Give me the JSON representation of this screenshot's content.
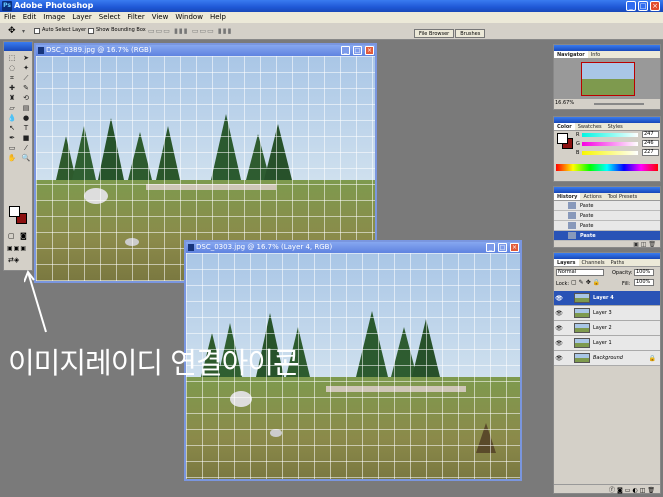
{
  "app": {
    "title": "Adobe Photoshop",
    "icon": "photoshop-icon"
  },
  "window_controls": {
    "minimize": "_",
    "maximize": "□",
    "close": "×"
  },
  "menu": [
    "File",
    "Edit",
    "Image",
    "Layer",
    "Select",
    "Filter",
    "View",
    "Window",
    "Help"
  ],
  "options": {
    "auto_select_layer": "Auto Select Layer",
    "show_bounding_box": "Show Bounding Box",
    "palette_well_tabs": [
      "File Browser",
      "Brushes"
    ]
  },
  "documents": [
    {
      "title": "DSC_0389.jpg @ 16.7% (RGB)"
    },
    {
      "title": "DSC_0303.jpg @ 16.7% (Layer 4, RGB)"
    }
  ],
  "navigator": {
    "tabs": [
      "Navigator",
      "Info"
    ],
    "zoom": "16.67%"
  },
  "color": {
    "tabs": [
      "Color",
      "Swatches",
      "Styles"
    ],
    "channels": [
      {
        "label": "R",
        "value": "247"
      },
      {
        "label": "G",
        "value": "246"
      },
      {
        "label": "B",
        "value": "227"
      }
    ],
    "foreground": "#ffffff",
    "background": "#8b1010"
  },
  "history": {
    "tabs": [
      "History",
      "Actions",
      "Tool Presets"
    ],
    "items": [
      {
        "label": "Paste",
        "active": false
      },
      {
        "label": "Paste",
        "active": false
      },
      {
        "label": "Paste",
        "active": false
      },
      {
        "label": "Paste",
        "active": true
      }
    ]
  },
  "layers": {
    "tabs": [
      "Layers",
      "Channels",
      "Paths"
    ],
    "blend_mode": "Normal",
    "opacity_label": "Opacity:",
    "opacity": "100%",
    "lock_label": "Lock:",
    "fill_label": "Fill:",
    "fill": "100%",
    "items": [
      {
        "name": "Layer 4",
        "active": true
      },
      {
        "name": "Layer 3",
        "active": false
      },
      {
        "name": "Layer 2",
        "active": false
      },
      {
        "name": "Layer 1",
        "active": false
      },
      {
        "name": "Background",
        "active": false
      }
    ]
  },
  "annotation": {
    "text": "이미지레이디  연결아이콘"
  }
}
